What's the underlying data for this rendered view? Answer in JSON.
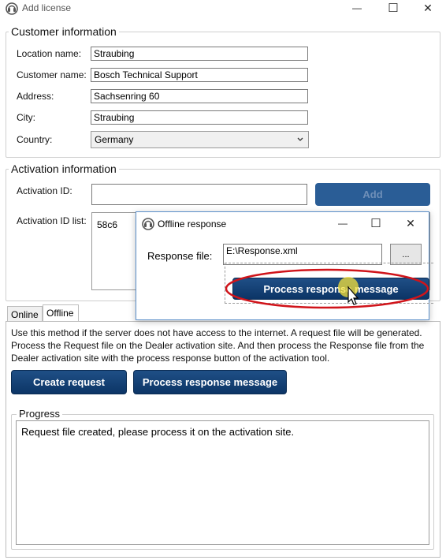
{
  "window": {
    "title": "Add license",
    "minimize_glyph": "—",
    "maximize_glyph": "☐",
    "close_glyph": "✕"
  },
  "customer": {
    "group_title": "Customer information",
    "location_label": "Location name:",
    "location_value": "Straubing",
    "customer_label": "Customer name:",
    "customer_value": "Bosch Technical Support",
    "address_label": "Address:",
    "address_value": "Sachsenring 60",
    "city_label": "City:",
    "city_value": "Straubing",
    "country_label": "Country:",
    "country_value": "Germany"
  },
  "activation": {
    "group_title": "Activation information",
    "id_label": "Activation ID:",
    "id_value": "",
    "add_label": "Add",
    "list_label": "Activation ID list:",
    "list_items": [
      "58c6"
    ]
  },
  "tabs": [
    {
      "label": "Online"
    },
    {
      "label": "Offline"
    }
  ],
  "offline": {
    "description": "Use this method if the server does not have access to the internet. A request file will be generated. Process the Request file on the Dealer activation site. And then process the Response file from the Dealer activation site with the process response button of the activation tool.",
    "create_request_label": "Create request",
    "process_response_label": "Process response message",
    "progress_title": "Progress",
    "progress_text": "Request file created, please process it on the activation site."
  },
  "dialog": {
    "title": "Offline response",
    "minimize_glyph": "—",
    "maximize_glyph": "☐",
    "close_glyph": "✕",
    "response_label": "Response file:",
    "response_value": "E:\\Response.xml",
    "browse_label": "...",
    "process_label": "Process response message"
  },
  "colors": {
    "button_blue": "#0c3566",
    "highlight_red": "#d0141a",
    "cursor_glow": "#f5e23a",
    "dialog_border": "#5b8fc9"
  }
}
